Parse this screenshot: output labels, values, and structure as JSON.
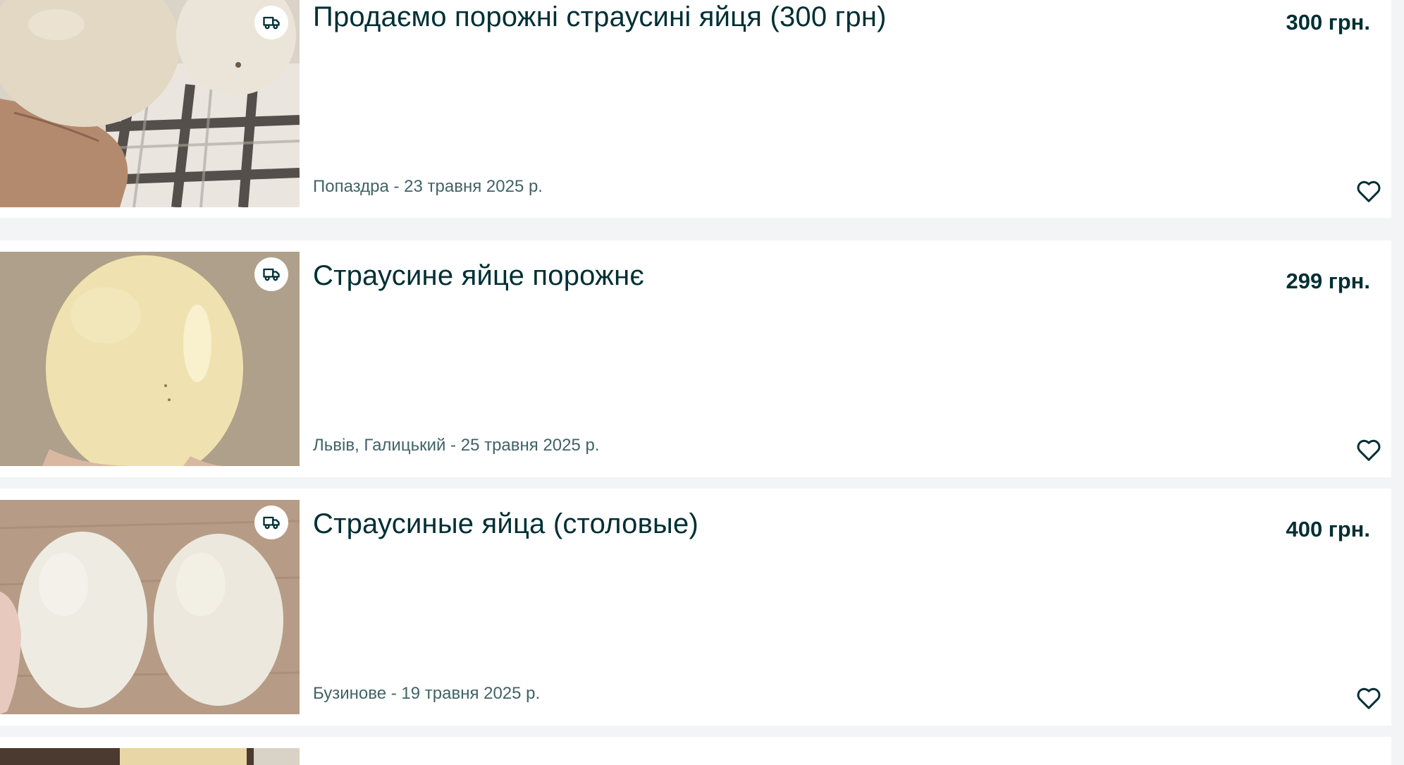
{
  "listings": [
    {
      "title": "Продаємо порожні страусині яйця (300 грн)",
      "price": "300 грн.",
      "location_date": "Попаздра - 23 травня 2025 р.",
      "delivery_icon": "truck-icon",
      "favorite_icon": "heart-outline-icon"
    },
    {
      "title": "Страусине яйце порожнє",
      "price": "299 грн.",
      "location_date": "Львів, Галицький - 25 травня 2025 р.",
      "delivery_icon": "truck-icon",
      "favorite_icon": "heart-outline-icon"
    },
    {
      "title": "Страусиные яйца (столовые)",
      "price": "400 грн.",
      "location_date": "Бузинове - 19 травня 2025 р.",
      "delivery_icon": "truck-icon",
      "favorite_icon": "heart-outline-icon"
    }
  ],
  "colors": {
    "background": "#f2f4f5",
    "card": "#ffffff",
    "text_primary": "#002f34",
    "text_secondary": "#406367"
  }
}
